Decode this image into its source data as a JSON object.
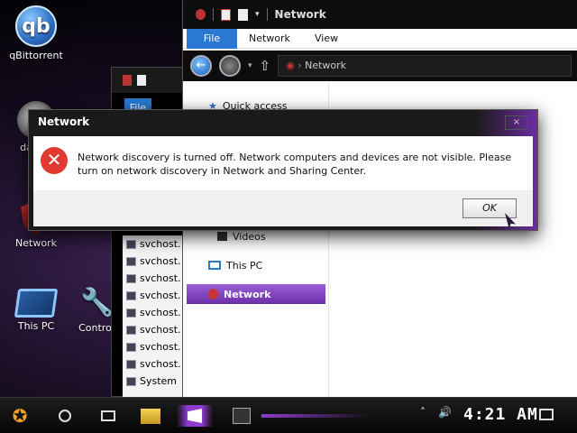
{
  "desktop": {
    "icons": [
      {
        "label": "qBittorrent",
        "glyph": "qb"
      },
      {
        "label": "da",
        "glyph": ""
      },
      {
        "label": "Network",
        "glyph": ""
      },
      {
        "label": "This PC",
        "glyph": ""
      },
      {
        "label": "Control",
        "glyph": "🔧"
      }
    ]
  },
  "bg_window": {
    "file_tab": "File",
    "processes": [
      "svchost.",
      "svchost.",
      "svchost.",
      "svchost.",
      "svchost.",
      "svchost.",
      "svchost.",
      "svchost.",
      "System"
    ],
    "first_row": "s"
  },
  "explorer": {
    "title": "Network",
    "ribbon": {
      "file": "File",
      "network": "Network",
      "view": "View"
    },
    "address": "Network",
    "nav": {
      "quick_access": "Quick access",
      "videos": "Videos",
      "this_pc": "This PC",
      "network": "Network"
    }
  },
  "dialog": {
    "title": "Network",
    "close": "×",
    "message": "Network discovery is turned off. Network computers and devices are not visible. Please turn on network discovery in Network and Sharing Center.",
    "ok": "OK",
    "icon": "error-icon"
  },
  "taskbar": {
    "start_glyph": "✪",
    "tray_chevron": "˄",
    "volume": "🔊",
    "clock": "4:21 AM",
    "colors": {
      "accent": "#8f3bcf"
    }
  }
}
